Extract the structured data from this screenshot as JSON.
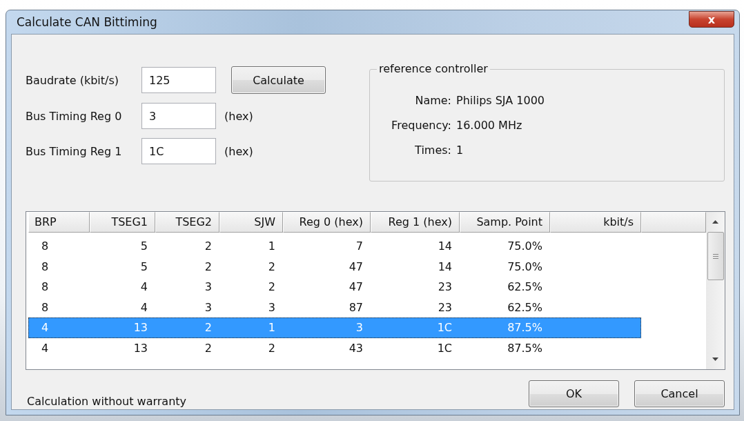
{
  "window": {
    "title": "Calculate CAN Bittiming",
    "close": "x"
  },
  "fields": [
    {
      "label": "Baudrate (kbit/s)",
      "value": "125",
      "button": "Calculate"
    },
    {
      "label": "Bus Timing Reg 0",
      "value": "3",
      "unit": "(hex)"
    },
    {
      "label": "Bus Timing Reg 1",
      "value": "1C",
      "unit": "(hex)"
    }
  ],
  "reference": {
    "legend": "reference controller",
    "items": [
      {
        "label": "Name:",
        "value": "Philips SJA 1000"
      },
      {
        "label": "Frequency:",
        "value": "16.000 MHz"
      },
      {
        "label": "Times:",
        "value": "1"
      }
    ]
  },
  "table": {
    "columns": [
      "BRP",
      "TSEG1",
      "TSEG2",
      "SJW",
      "Reg 0 (hex)",
      "Reg 1 (hex)",
      "Samp. Point",
      "kbit/s"
    ],
    "rows": [
      {
        "cells": [
          "8",
          "5",
          "2",
          "1",
          "7",
          "14",
          "75.0%"
        ],
        "selected": false
      },
      {
        "cells": [
          "8",
          "5",
          "2",
          "2",
          "47",
          "14",
          "75.0%"
        ],
        "selected": false
      },
      {
        "cells": [
          "8",
          "4",
          "3",
          "2",
          "47",
          "23",
          "62.5%"
        ],
        "selected": false
      },
      {
        "cells": [
          "8",
          "4",
          "3",
          "3",
          "87",
          "23",
          "62.5%"
        ],
        "selected": false
      },
      {
        "cells": [
          "4",
          "13",
          "2",
          "1",
          "3",
          "1C",
          "87.5%"
        ],
        "selected": true
      },
      {
        "cells": [
          "4",
          "13",
          "2",
          "2",
          "43",
          "1C",
          "87.5%"
        ],
        "selected": false
      }
    ]
  },
  "footer": {
    "note": "Calculation without warranty",
    "buttons": [
      "OK",
      "Cancel"
    ]
  }
}
